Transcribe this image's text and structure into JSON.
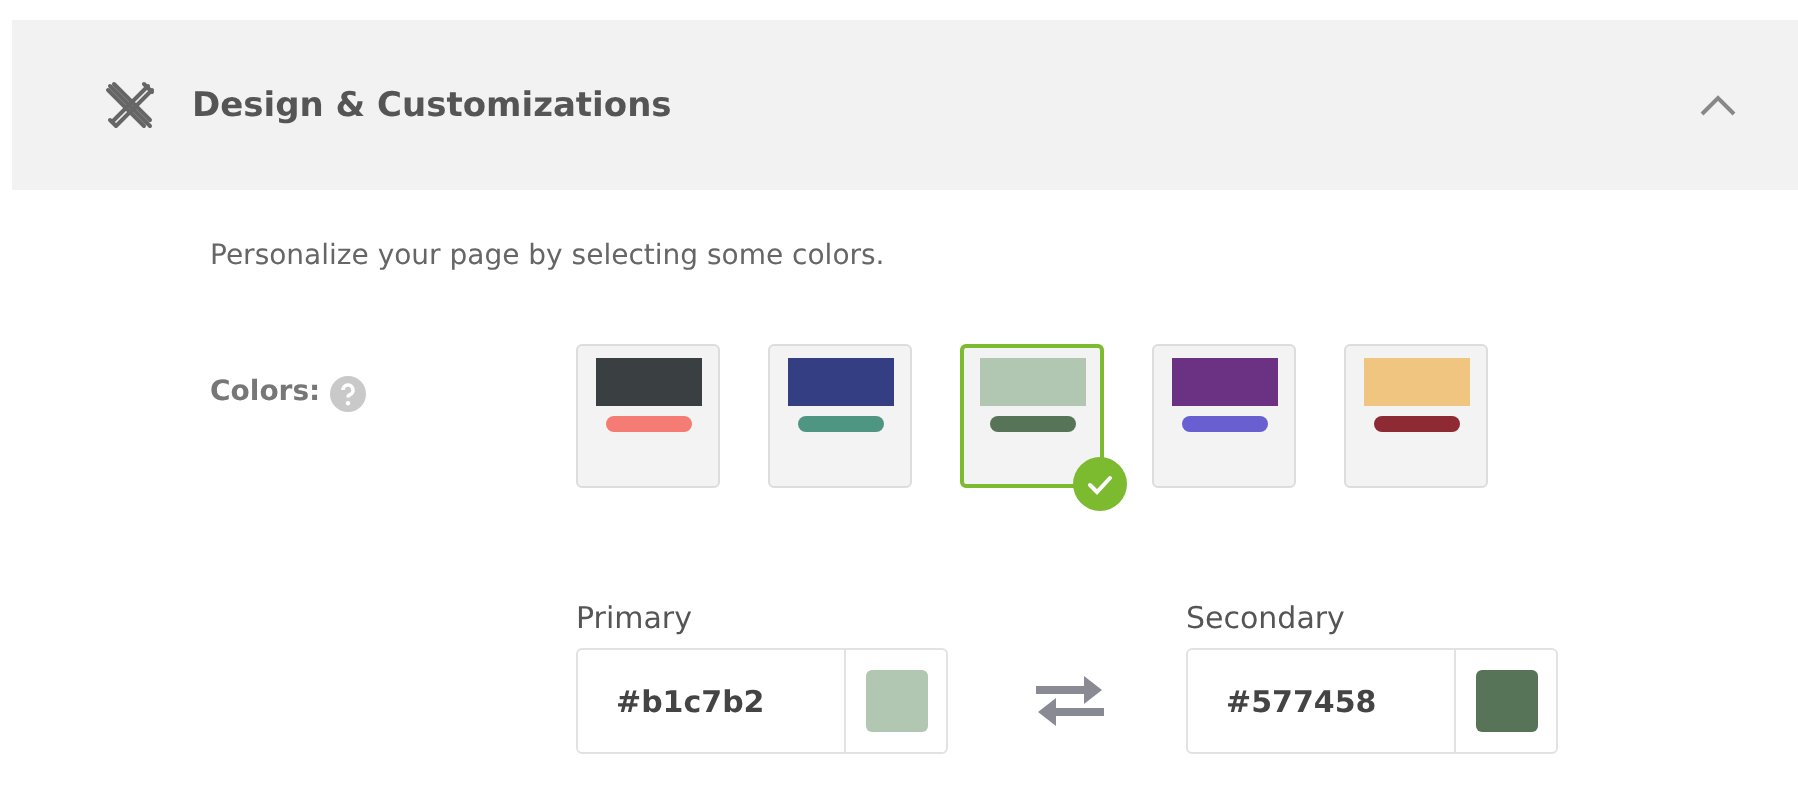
{
  "section": {
    "title": "Design & Customizations",
    "expanded": true
  },
  "description": "Personalize your page by selecting some colors.",
  "colors_label": "Colors:",
  "themes": [
    {
      "block": {
        "color": "#3a3f42"
      },
      "bar": {
        "color": "#f47c74"
      },
      "selected": false
    },
    {
      "block": {
        "color": "#343e83"
      },
      "bar": {
        "color": "#4f9682"
      },
      "selected": false
    },
    {
      "block": {
        "color": "#b1c7b2"
      },
      "bar": {
        "color": "#577458"
      },
      "selected": true
    },
    {
      "block": {
        "color": "#6b3283"
      },
      "bar": {
        "color": "#6a5fd0"
      },
      "selected": false
    },
    {
      "block": {
        "color": "#f0c57f"
      },
      "bar": {
        "color": "#8e2a34"
      },
      "selected": false
    }
  ],
  "primary": {
    "label": "Primary",
    "value": "#b1c7b2",
    "color": "#b1c7b2"
  },
  "secondary": {
    "label": "Secondary",
    "value": "#577458",
    "color": "#577458"
  }
}
